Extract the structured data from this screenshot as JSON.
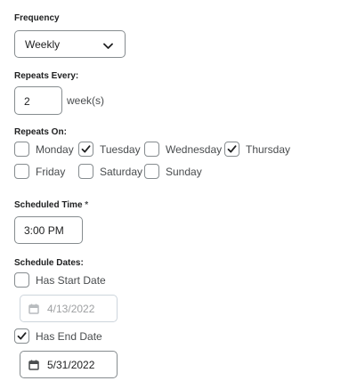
{
  "frequency": {
    "label": "Frequency",
    "value": "Weekly",
    "icon": "chevron-down-icon"
  },
  "repeats_every": {
    "label": "Repeats Every:",
    "value": "2",
    "units": "week(s)"
  },
  "repeats_on": {
    "label": "Repeats On:",
    "days": [
      {
        "label": "Monday",
        "checked": false
      },
      {
        "label": "Tuesday",
        "checked": true
      },
      {
        "label": "Wednesday",
        "checked": false
      },
      {
        "label": "Thursday",
        "checked": true
      },
      {
        "label": "Friday",
        "checked": false
      },
      {
        "label": "Saturday",
        "checked": false
      },
      {
        "label": "Sunday",
        "checked": false
      }
    ]
  },
  "scheduled_time": {
    "label": "Scheduled Time",
    "required_marker": "*",
    "value": "3:00 PM"
  },
  "schedule_dates": {
    "label": "Schedule Dates:",
    "start": {
      "label": "Has Start Date",
      "checked": false,
      "date": "4/13/2022",
      "enabled": false
    },
    "end": {
      "label": "Has End Date",
      "checked": true,
      "date": "5/31/2022",
      "enabled": true
    }
  },
  "colors": {
    "text": "#494c4e",
    "heading": "#202122",
    "border": "#868c8f",
    "disabled_border": "#cdd5dc",
    "disabled_text": "#9ea0a2"
  }
}
